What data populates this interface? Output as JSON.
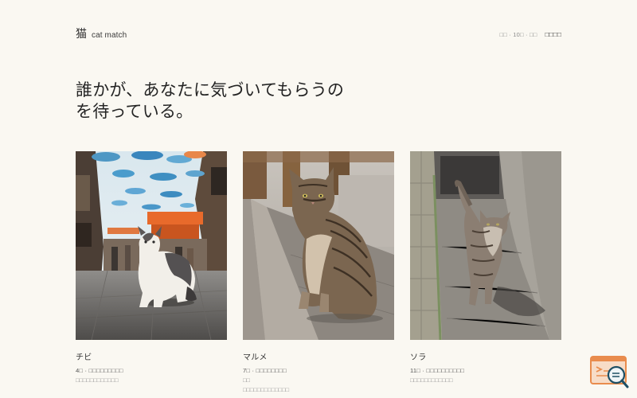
{
  "header": {
    "brand_kanji": "猫",
    "brand_text": "cat match",
    "meta_text": "□□ · 10□ · □□",
    "nav_link": "□□□□"
  },
  "hero": {
    "line1": "誰かが、あなたに気づいてもらうの",
    "line2": "を待っている。"
  },
  "cards": [
    {
      "name": "チビ",
      "age": "4□ · □□□□□□□□□",
      "note": "□□□□□□□□□□□□",
      "note2": ""
    },
    {
      "name": "マルメ",
      "age": "7□ · □□□□□□□□",
      "note": "□□",
      "note2": "□□□□□□□□□□□□□"
    },
    {
      "name": "ソラ",
      "age": "11□ · □□□□□□□□□□",
      "note": "□□□□□□□□□□□□",
      "note2": ""
    }
  ],
  "icons": {
    "corner": "search-panel-icon"
  }
}
